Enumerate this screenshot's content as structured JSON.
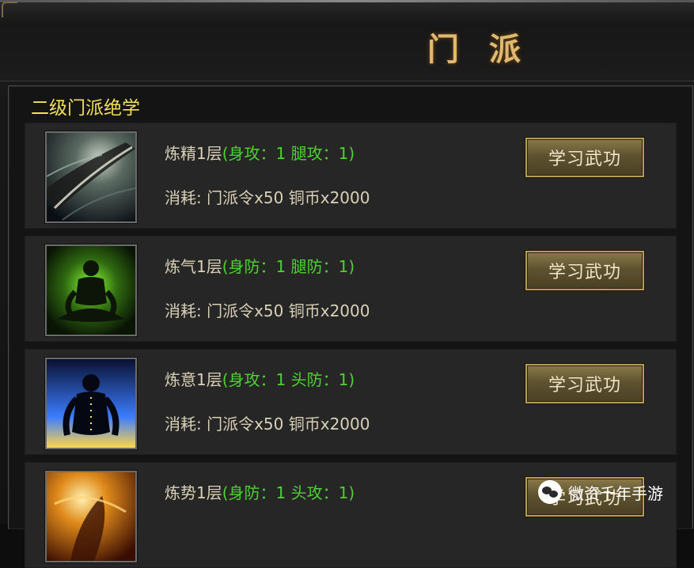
{
  "window": {
    "title": "门派"
  },
  "section": {
    "title": "二级门派绝学"
  },
  "skills": [
    {
      "name": "炼精1层",
      "stats": "(身攻：1 腿攻：1)",
      "cost": "消耗: 门派令x50 铜币x2000",
      "button_label": "学习武功",
      "icon": "blade-slash-icon"
    },
    {
      "name": "炼气1层",
      "stats": "(身防：1 腿防：1)",
      "cost": "消耗: 门派令x50 铜币x2000",
      "button_label": "学习武功",
      "icon": "green-aura-meditation-icon"
    },
    {
      "name": "炼意1层",
      "stats": "(身攻：1 头防：1)",
      "cost": "消耗: 门派令x50 铜币x2000",
      "button_label": "学习武功",
      "icon": "blue-flame-meditation-icon"
    },
    {
      "name": "炼势1层",
      "stats": "(身防：1 头攻：1)",
      "cost": "",
      "button_label": "学习武功",
      "icon": "fire-figure-icon"
    }
  ],
  "watermark": {
    "text": "微资千年手游"
  },
  "colors": {
    "title": "#e0b870",
    "section_title": "#f2e25a",
    "stats_green": "#4fd132",
    "text": "#d9d1b7",
    "row_bg": "#262626"
  }
}
